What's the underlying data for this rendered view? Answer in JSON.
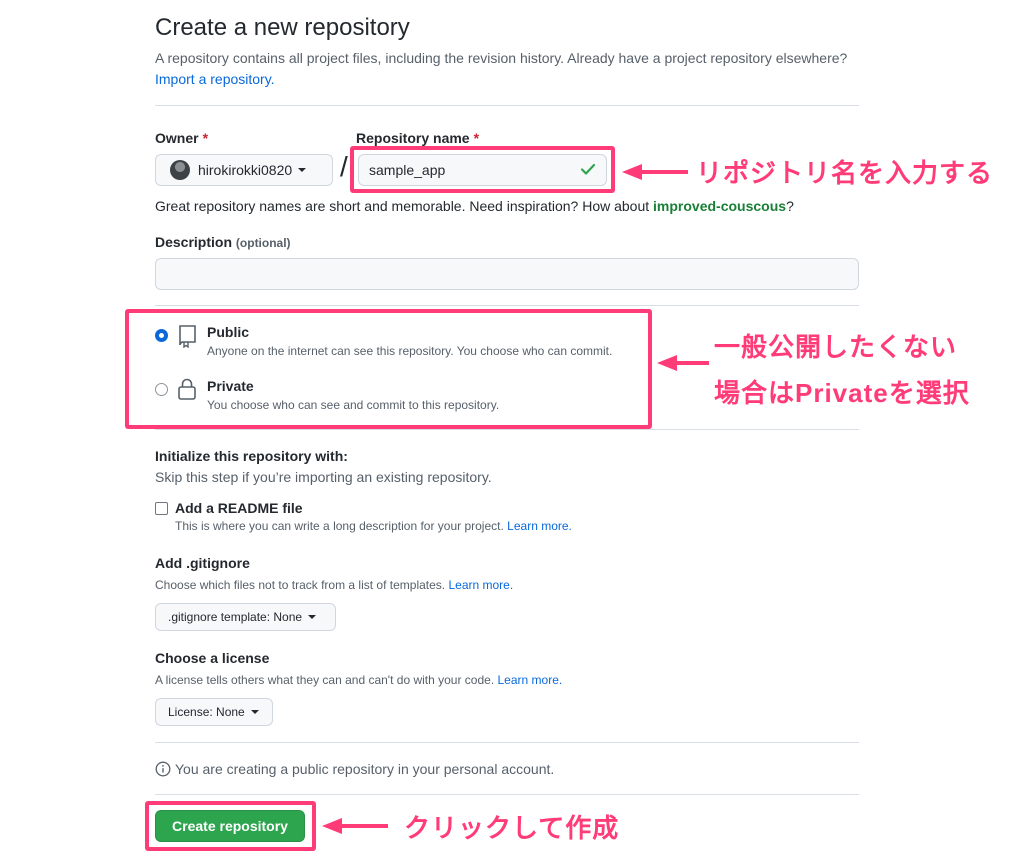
{
  "page": {
    "title": "Create a new repository",
    "subtitle_text": "A repository contains all project files, including the revision history. Already have a project repository elsewhere?",
    "import_link": "Import a repository."
  },
  "owner": {
    "label": "Owner",
    "required_mark": "*",
    "value": "hirokirokki0820"
  },
  "separator": "/",
  "repo_name": {
    "label": "Repository name",
    "required_mark": "*",
    "value": "sample_app"
  },
  "name_hint": {
    "text": "Great repository names are short and memorable. Need inspiration? How about",
    "suggestion": "improved-couscous",
    "suffix": "?"
  },
  "description": {
    "label": "Description",
    "optional": "(optional)",
    "value": ""
  },
  "visibility": {
    "public": {
      "label": "Public",
      "desc": "Anyone on the internet can see this repository. You choose who can commit.",
      "selected": true
    },
    "private": {
      "label": "Private",
      "desc": "You choose who can see and commit to this repository.",
      "selected": false
    }
  },
  "init": {
    "heading": "Initialize this repository with:",
    "subtext": "Skip this step if you’re importing an existing repository.",
    "readme_label": "Add a README file",
    "readme_desc": "This is where you can write a long description for your project.",
    "learn_more": "Learn more."
  },
  "gitignore": {
    "heading": "Add .gitignore",
    "desc": "Choose which files not to track from a list of templates.",
    "learn_more": "Learn more.",
    "button": ".gitignore template: None"
  },
  "license": {
    "heading": "Choose a license",
    "desc": "A license tells others what they can and can't do with your code.",
    "learn_more": "Learn more.",
    "button": "License: None"
  },
  "notice": "You are creating a public repository in your personal account.",
  "submit_label": "Create repository",
  "annotations": {
    "repo_name": "リポジトリ名を入力する",
    "visibility_line1": "一般公開したくない",
    "visibility_line2": "場合はPrivateを選択",
    "create": "クリックして作成"
  },
  "colors": {
    "accent_pink": "#ff3b78",
    "link_blue": "#0969da",
    "success_green": "#2da44e",
    "suggestion_green": "#1a7f37"
  }
}
